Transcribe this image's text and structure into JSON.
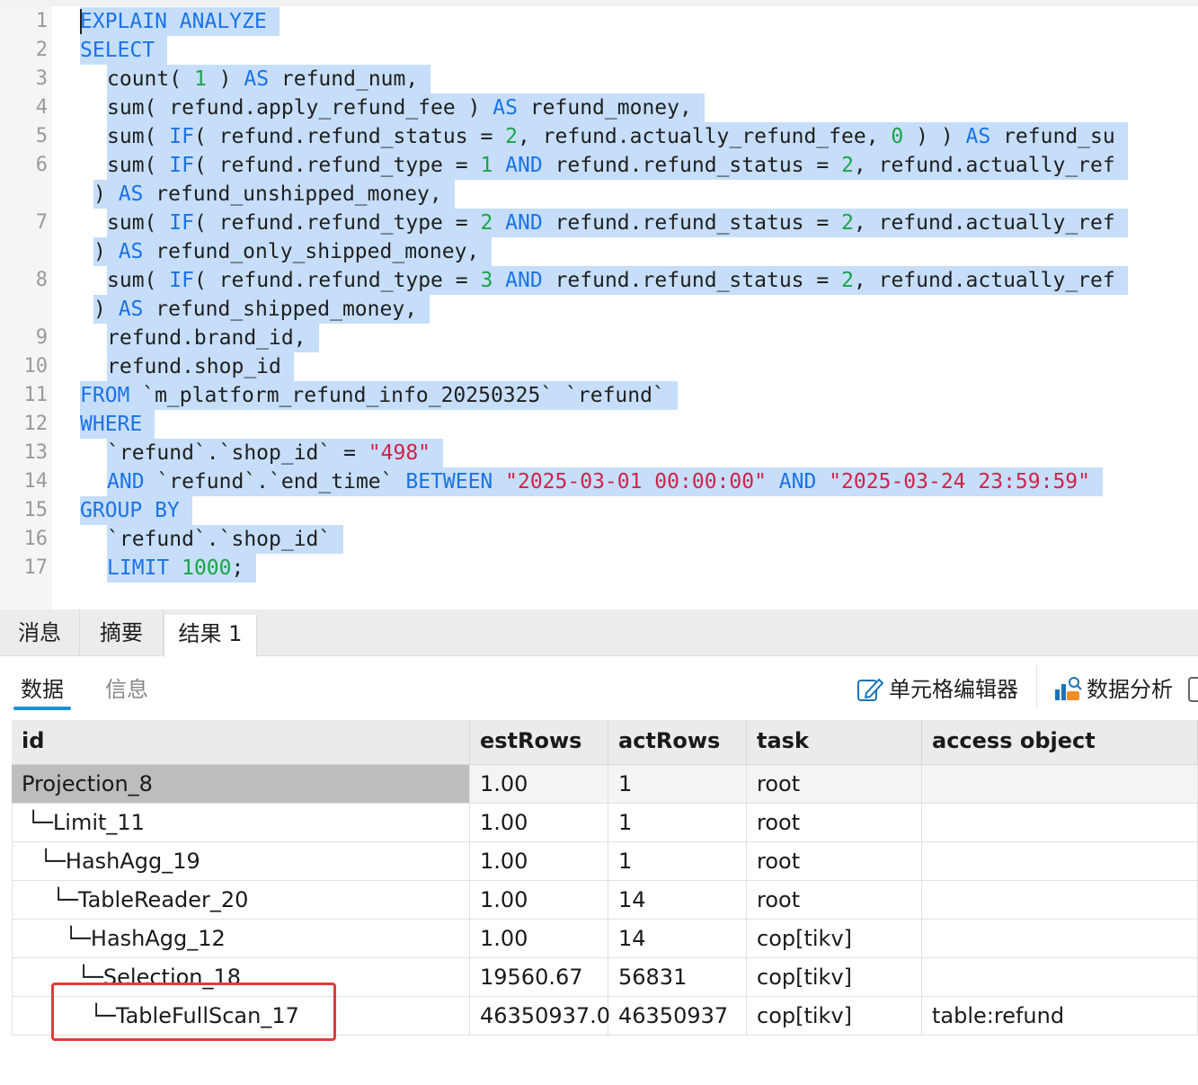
{
  "editor": {
    "lines": [
      {
        "num": "1",
        "indent": 0,
        "tokens": [
          {
            "t": "EXPLAIN ANALYZE",
            "c": "kw"
          }
        ]
      },
      {
        "num": "2",
        "indent": 0,
        "tokens": [
          {
            "t": "SELECT",
            "c": "kw"
          }
        ]
      },
      {
        "num": "3",
        "indent": 2,
        "tokens": [
          {
            "t": "count( "
          },
          {
            "t": "1",
            "c": "num"
          },
          {
            "t": " ) "
          },
          {
            "t": "AS",
            "c": "kw"
          },
          {
            "t": " refund_num,"
          }
        ]
      },
      {
        "num": "4",
        "indent": 2,
        "tokens": [
          {
            "t": "sum( refund.apply_refund_fee ) "
          },
          {
            "t": "AS",
            "c": "kw"
          },
          {
            "t": " refund_money,"
          }
        ]
      },
      {
        "num": "5",
        "indent": 2,
        "tokens": [
          {
            "t": "sum( "
          },
          {
            "t": "IF",
            "c": "kw"
          },
          {
            "t": "( refund.refund_status = "
          },
          {
            "t": "2",
            "c": "num"
          },
          {
            "t": ", refund.actually_refund_fee, "
          },
          {
            "t": "0",
            "c": "num"
          },
          {
            "t": " ) ) "
          },
          {
            "t": "AS",
            "c": "kw"
          },
          {
            "t": " refund_su"
          }
        ]
      },
      {
        "num": "6",
        "indent": 2,
        "tokens": [
          {
            "t": "sum( "
          },
          {
            "t": "IF",
            "c": "kw"
          },
          {
            "t": "( refund.refund_type = "
          },
          {
            "t": "1",
            "c": "num"
          },
          {
            "t": " "
          },
          {
            "t": "AND",
            "c": "kw"
          },
          {
            "t": " refund.refund_status = "
          },
          {
            "t": "2",
            "c": "num"
          },
          {
            "t": ", refund.actually_ref"
          }
        ]
      },
      {
        "num": "",
        "indent": 1,
        "tokens": [
          {
            "t": ") "
          },
          {
            "t": "AS",
            "c": "kw"
          },
          {
            "t": " refund_unshipped_money,"
          }
        ]
      },
      {
        "num": "7",
        "indent": 2,
        "tokens": [
          {
            "t": "sum( "
          },
          {
            "t": "IF",
            "c": "kw"
          },
          {
            "t": "( refund.refund_type = "
          },
          {
            "t": "2",
            "c": "num"
          },
          {
            "t": " "
          },
          {
            "t": "AND",
            "c": "kw"
          },
          {
            "t": " refund.refund_status = "
          },
          {
            "t": "2",
            "c": "num"
          },
          {
            "t": ", refund.actually_ref"
          }
        ]
      },
      {
        "num": "",
        "indent": 1,
        "tokens": [
          {
            "t": ") "
          },
          {
            "t": "AS",
            "c": "kw"
          },
          {
            "t": " refund_only_shipped_money,"
          }
        ]
      },
      {
        "num": "8",
        "indent": 2,
        "tokens": [
          {
            "t": "sum( "
          },
          {
            "t": "IF",
            "c": "kw"
          },
          {
            "t": "( refund.refund_type = "
          },
          {
            "t": "3",
            "c": "num"
          },
          {
            "t": " "
          },
          {
            "t": "AND",
            "c": "kw"
          },
          {
            "t": " refund.refund_status = "
          },
          {
            "t": "2",
            "c": "num"
          },
          {
            "t": ", refund.actually_ref"
          }
        ]
      },
      {
        "num": "",
        "indent": 1,
        "tokens": [
          {
            "t": ") "
          },
          {
            "t": "AS",
            "c": "kw"
          },
          {
            "t": " refund_shipped_money,"
          }
        ]
      },
      {
        "num": "9",
        "indent": 2,
        "tokens": [
          {
            "t": "refund.brand_id,"
          }
        ]
      },
      {
        "num": "10",
        "indent": 2,
        "tokens": [
          {
            "t": "refund.shop_id"
          }
        ]
      },
      {
        "num": "11",
        "indent": 0,
        "tokens": [
          {
            "t": "FROM",
            "c": "kw"
          },
          {
            "t": " `m_platform_refund_info_20250325` `refund`"
          }
        ]
      },
      {
        "num": "12",
        "indent": 0,
        "tokens": [
          {
            "t": "WHERE",
            "c": "kw"
          }
        ]
      },
      {
        "num": "13",
        "indent": 2,
        "tokens": [
          {
            "t": "`refund`.`shop_id` = "
          },
          {
            "t": "\"498\"",
            "c": "str"
          }
        ]
      },
      {
        "num": "14",
        "indent": 2,
        "tokens": [
          {
            "t": "AND",
            "c": "kw"
          },
          {
            "t": " `refund`.`end_time` "
          },
          {
            "t": "BETWEEN",
            "c": "kw"
          },
          {
            "t": " "
          },
          {
            "t": "\"2025-03-01 00:00:00\"",
            "c": "str"
          },
          {
            "t": " "
          },
          {
            "t": "AND",
            "c": "kw"
          },
          {
            "t": " "
          },
          {
            "t": "\"2025-03-24 23:59:59\"",
            "c": "str"
          }
        ]
      },
      {
        "num": "15",
        "indent": 0,
        "tokens": [
          {
            "t": "GROUP BY",
            "c": "kw"
          }
        ]
      },
      {
        "num": "16",
        "indent": 2,
        "tokens": [
          {
            "t": "`refund`.`shop_id`"
          }
        ]
      },
      {
        "num": "17",
        "indent": 2,
        "tokens": [
          {
            "t": "LIMIT",
            "c": "kw"
          },
          {
            "t": " "
          },
          {
            "t": "1000",
            "c": "num"
          },
          {
            "t": ";"
          }
        ]
      }
    ]
  },
  "result_tabs": [
    "消息",
    "摘要",
    "结果 1"
  ],
  "active_result_tab": "结果 1",
  "sub_tabs": [
    "数据",
    "信息"
  ],
  "active_sub_tab": "数据",
  "toolbar": {
    "cell_editor_label": "单元格编辑器",
    "cell_editor_icon": "edit-icon",
    "data_analysis_label": "数据分析",
    "data_analysis_icon": "data-analysis-icon"
  },
  "grid": {
    "columns": [
      "id",
      "estRows",
      "actRows",
      "task",
      "access object"
    ],
    "rows": [
      [
        "Projection_8",
        "1.00",
        "1",
        "root",
        ""
      ],
      [
        "└─Limit_11",
        "1.00",
        "1",
        "root",
        ""
      ],
      [
        "└─HashAgg_19",
        "1.00",
        "1",
        "root",
        ""
      ],
      [
        "└─TableReader_20",
        "1.00",
        "14",
        "root",
        ""
      ],
      [
        "└─HashAgg_12",
        "1.00",
        "14",
        "cop[tikv]",
        ""
      ],
      [
        "└─Selection_18",
        "19560.67",
        "56831",
        "cop[tikv]",
        ""
      ],
      [
        "└─TableFullScan_17",
        "46350937.0",
        "46350937",
        "cop[tikv]",
        "table:refund"
      ]
    ]
  },
  "colors": {
    "keyword": "#1a73e8",
    "number": "#1aa34a",
    "string": "#d4204a",
    "selection": "#c6defa",
    "highlight_box": "#e03b3b",
    "active_underline": "#1a8fd8"
  }
}
